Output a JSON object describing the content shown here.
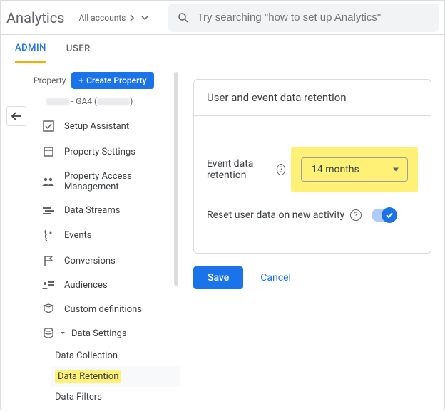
{
  "header": {
    "brand": "Analytics",
    "account_switch": "All accounts",
    "search_placeholder": "Try searching \"how to set up Analytics\""
  },
  "tabs": {
    "admin": "ADMIN",
    "user": "USER"
  },
  "sidebar": {
    "property_label": "Property",
    "create_button": "Create Property",
    "property_name_mid": "- GA4 (",
    "items": {
      "setup_assistant": "Setup Assistant",
      "property_settings": "Property Settings",
      "property_access": "Property Access Management",
      "data_streams": "Data Streams",
      "events": "Events",
      "conversions": "Conversions",
      "audiences": "Audiences",
      "custom_definitions": "Custom definitions",
      "data_settings": "Data Settings"
    },
    "sub_items": {
      "data_collection": "Data Collection",
      "data_retention": "Data Retention",
      "data_filters": "Data Filters"
    }
  },
  "main": {
    "card_title": "User and event data retention",
    "event_retention_label": "Event data retention",
    "event_retention_value": "14 months",
    "reset_label": "Reset user data on new activity",
    "save": "Save",
    "cancel": "Cancel"
  }
}
